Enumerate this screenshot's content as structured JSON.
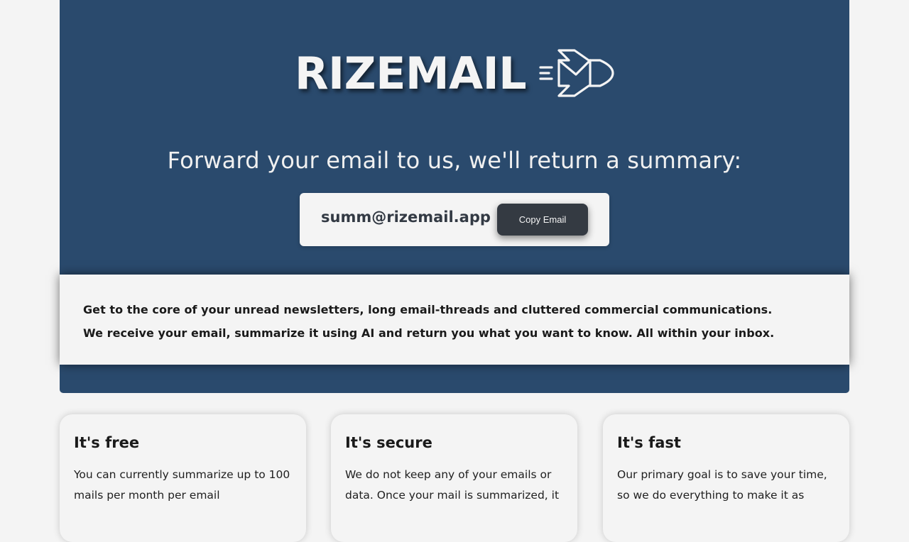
{
  "brand": {
    "name": "RIZEMAIL",
    "tagline": "Forward your email to us, we'll return a summary:",
    "colors": {
      "hero_bg": "#2a4a6d",
      "button_bg": "#343a42",
      "page_bg": "#f4f4f4"
    }
  },
  "email_box": {
    "address": "summ@rizemail.app",
    "copy_label": "Copy Email"
  },
  "intro": {
    "line1": "Get to the core of your unread newsletters, long email-threads and cluttered commercial communications.",
    "line2": "We receive your email, summarize it using AI and return you what you want to know. All within your inbox."
  },
  "features": [
    {
      "title": "It's free",
      "text": "You can currently summarize up to 100 mails per month per email"
    },
    {
      "title": "It's secure",
      "text": "We do not keep any of your emails or data. Once your mail is summarized, it"
    },
    {
      "title": "It's fast",
      "text": "Our primary goal is to save your time, so we do everything to make it as"
    }
  ],
  "icons": {
    "logo": "rocket-mail-icon"
  }
}
